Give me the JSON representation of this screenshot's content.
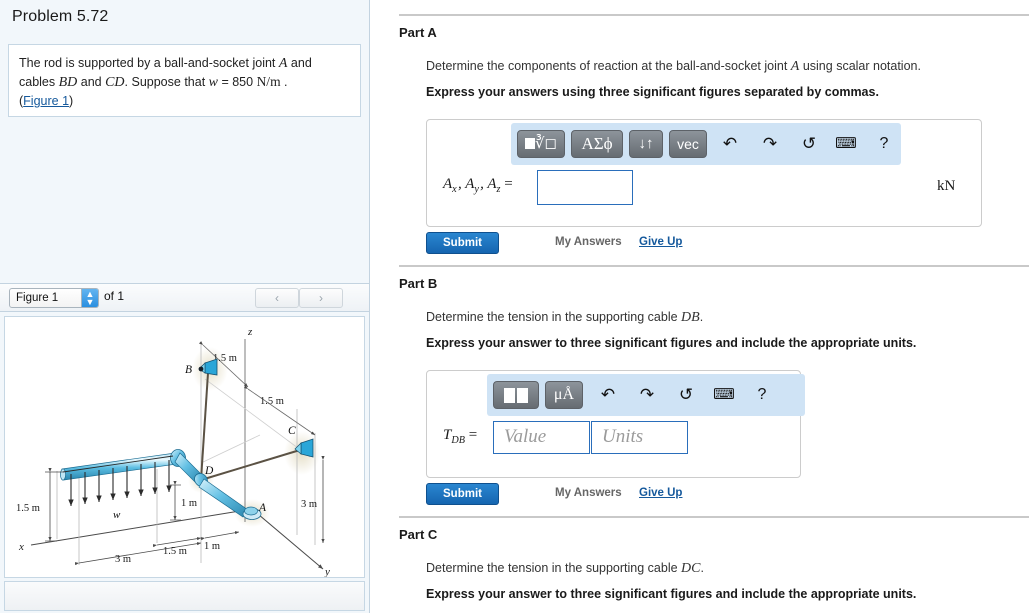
{
  "problem": {
    "title": "Problem 5.72",
    "statement_line1_pre": "The rod is supported by a ball-and-socket joint ",
    "statement_A": "A",
    "statement_line1_post": " and",
    "statement_line2_pre": "cables ",
    "statement_BD": "BD",
    "statement_line2_mid": " and ",
    "statement_CD": "CD",
    "statement_line2_post": ". Suppose that ",
    "statement_w": "w",
    "statement_eq": " = 850 ",
    "statement_units": "N/m",
    "statement_end": " .",
    "figure_link": "Figure 1",
    "paren_open": "(",
    "paren_close": ")"
  },
  "figure_panel": {
    "select_value": "Figure 1",
    "select_chevron": "chevron-updown-icon",
    "count_label": "of 1",
    "prev_label": "‹",
    "next_label": "›"
  },
  "figure": {
    "axis_z": "z",
    "axis_x": "x",
    "axis_y": "y",
    "point_A": "A",
    "point_B": "B",
    "point_C": "C",
    "point_D": "D",
    "load_w": "w",
    "dim_15_top": "1.5 m",
    "dim_15_mid": "1.5 m",
    "dim_15_left": "1.5 m",
    "dim_15_bottom": "1.5 m",
    "dim_1m_vert": "1 m",
    "dim_1m_bottom": "1 m",
    "dim_3m_bottom": "3 m",
    "dim_3m_right": "3 m"
  },
  "parts": [
    {
      "id": "A",
      "heading": "Part A",
      "prompt_pre": "Determine the components of reaction at the ball-and-socket joint ",
      "prompt_math": "A",
      "prompt_post": " using scalar notation.",
      "instruction": "Express your answers using three significant figures separated by commas.",
      "toolbar": {
        "buttons": [
          {
            "name": "math-template-button",
            "label": "■√□"
          },
          {
            "name": "greek-symbols-button",
            "label": "ΑΣϕ"
          },
          {
            "name": "updown-arrows-button",
            "label": "↓↑"
          },
          {
            "name": "vector-button",
            "label": "vec"
          }
        ],
        "icons": [
          {
            "name": "undo-icon",
            "glyph": "↶"
          },
          {
            "name": "redo-icon",
            "glyph": "↷"
          },
          {
            "name": "reset-icon",
            "glyph": "↺"
          },
          {
            "name": "keyboard-icon",
            "glyph": "⌨"
          },
          {
            "name": "help-icon",
            "glyph": "?"
          }
        ]
      },
      "answer_label_parts": [
        "A",
        "x",
        "A",
        "y",
        "A",
        "z"
      ],
      "answer_value": "",
      "answer_placeholder": "",
      "units_suffix": "kN",
      "submit_label": "Submit",
      "my_answers_label": "My Answers",
      "give_up_label": "Give Up"
    },
    {
      "id": "B",
      "heading": "Part B",
      "prompt_pre": "Determine the tension in the supporting cable ",
      "prompt_math": "DB",
      "prompt_post": ".",
      "instruction": "Express your answer to three significant figures and include the appropriate units.",
      "toolbar": {
        "buttons": [
          {
            "name": "math-template-button",
            "label": "■□"
          },
          {
            "name": "units-button",
            "label": "μÅ"
          }
        ],
        "icons": [
          {
            "name": "undo-icon",
            "glyph": "↶"
          },
          {
            "name": "redo-icon",
            "glyph": "↷"
          },
          {
            "name": "reset-icon",
            "glyph": "↺"
          },
          {
            "name": "keyboard-icon",
            "glyph": "⌨"
          },
          {
            "name": "help-icon",
            "glyph": "?"
          }
        ]
      },
      "answer_symbol": "T",
      "answer_subscript": "DB",
      "value_placeholder": "Value",
      "units_placeholder": "Units",
      "value_current": "",
      "units_current": "",
      "submit_label": "Submit",
      "my_answers_label": "My Answers",
      "give_up_label": "Give Up"
    },
    {
      "id": "C",
      "heading": "Part C",
      "prompt_pre": "Determine the tension in the supporting cable ",
      "prompt_math": "DC",
      "prompt_post": ".",
      "instruction": "Express your answer to three significant figures and include the appropriate units."
    }
  ],
  "colors": {
    "left_panel_bg": "#f2f7fb",
    "accent_blue": "#1565b0",
    "link_blue": "#15599c",
    "toolbar_blue": "#cfe3f5",
    "button_gray": "#6b7177",
    "input_border": "#2a6ebb",
    "rod_cyan": "#3fa9d6"
  }
}
